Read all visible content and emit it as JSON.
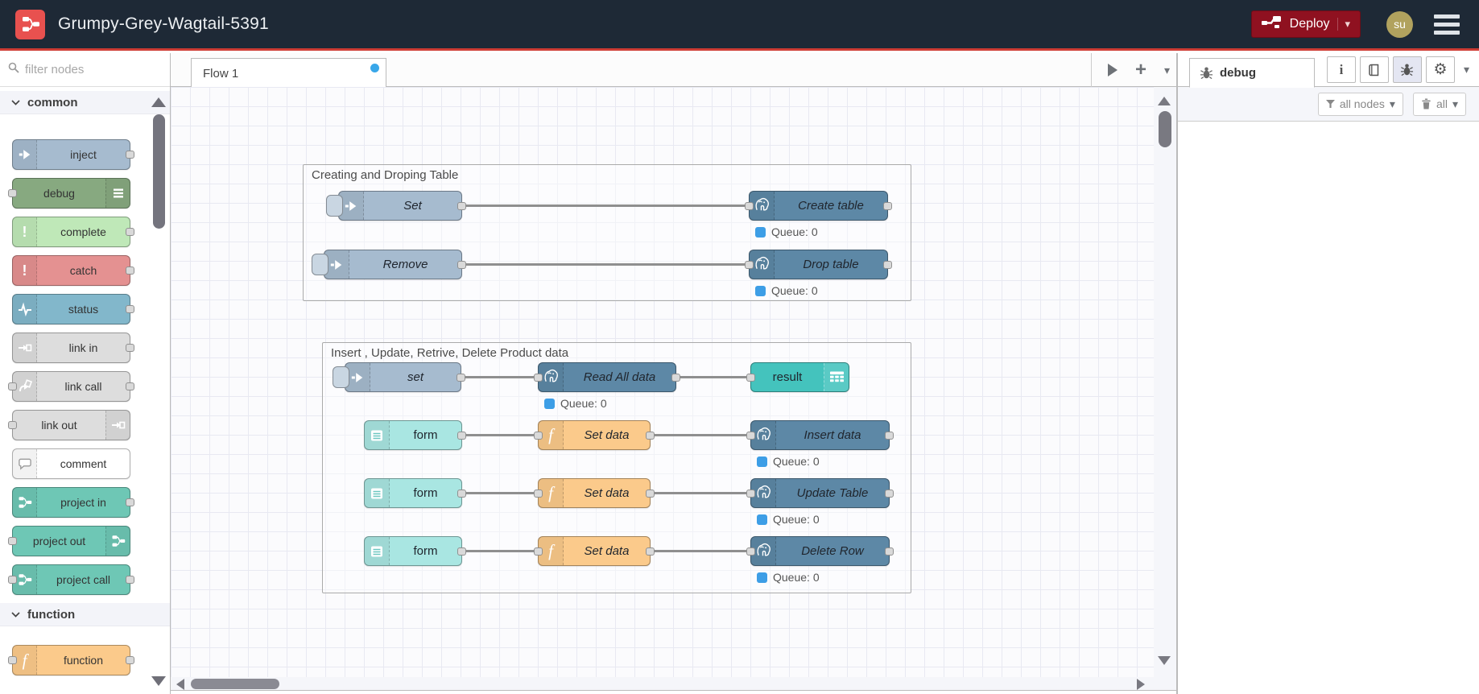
{
  "colors": {
    "headerbg": "#1e2936",
    "headerline": "#ce3c34",
    "logobg": "#e8514f",
    "deploybg": "#8f1120",
    "avatarbg": "#b1a25e",
    "canvasbg": "#fbfbfd",
    "grid": "#e8e9f2",
    "inject": "#a6bbcf",
    "debug": "#87a980",
    "complete": "#bfe8b8",
    "catch": "#e49191",
    "status": "#82b7cb",
    "link": "#dddddd",
    "comment": "#ffffff",
    "project": "#6ec7b5",
    "function": "#fbca8b",
    "postgres": "#5d88a6",
    "table": "#44c3bd",
    "form": "#a9e6e2",
    "wire": "#8f8f8f",
    "port": "#d9d9d9",
    "portborder": "#909090",
    "statusdot": "#3d9ee6",
    "groupborder": "#aaaaaa",
    "tabdot": "#39a7e9"
  },
  "header": {
    "title": "Grumpy-Grey-Wagtail-5391",
    "deploy_label": "Deploy",
    "user_initials": "su"
  },
  "palette": {
    "filter_placeholder": "filter nodes",
    "category_common": "common",
    "category_function": "function",
    "nodes": {
      "inject": "inject",
      "debug": "debug",
      "complete": "complete",
      "catch": "catch",
      "status": "status",
      "link_in": "link in",
      "link_call": "link call",
      "link_out": "link out",
      "comment": "comment",
      "project_in": "project in",
      "project_out": "project out",
      "project_call": "project call",
      "function": "function"
    }
  },
  "workspace": {
    "tab_flow1": "Flow 1",
    "group1": {
      "title": "Creating and Droping Table"
    },
    "group2": {
      "title": "Insert , Update, Retrive, Delete Product data"
    },
    "nodes": {
      "set1": {
        "label": "Set"
      },
      "create_table": {
        "label": "Create table",
        "status": "Queue: 0"
      },
      "remove": {
        "label": "Remove"
      },
      "drop_table": {
        "label": "Drop table",
        "status": "Queue: 0"
      },
      "set2": {
        "label": "set"
      },
      "read_all": {
        "label": "Read All data",
        "status": "Queue: 0"
      },
      "result": {
        "label": "result"
      },
      "form1": {
        "label": "form"
      },
      "setdata1": {
        "label": "Set data"
      },
      "insert_data": {
        "label": "Insert data",
        "status": "Queue: 0"
      },
      "form2": {
        "label": "form"
      },
      "setdata2": {
        "label": "Set data"
      },
      "update_table": {
        "label": "Update Table",
        "status": "Queue: 0"
      },
      "form3": {
        "label": "form"
      },
      "setdata3": {
        "label": "Set data"
      },
      "delete_row": {
        "label": "Delete Row",
        "status": "Queue: 0"
      }
    }
  },
  "sidebar": {
    "tab_debug": "debug",
    "filter_label": "all nodes",
    "trash_label": "all"
  }
}
